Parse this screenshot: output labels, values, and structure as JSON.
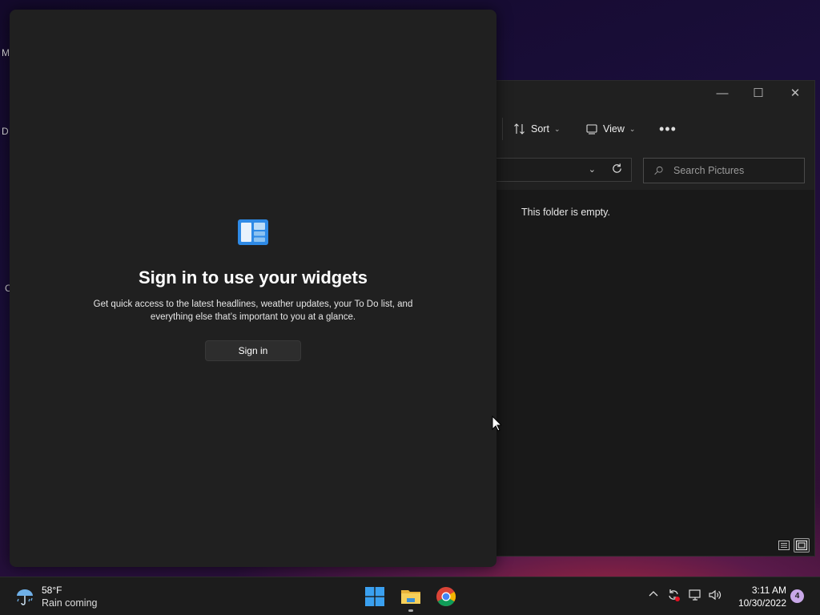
{
  "desktop": {
    "labels": [
      "M",
      "D",
      "C"
    ]
  },
  "explorer": {
    "controls": {
      "minimize": "—",
      "maximize": "☐",
      "close": "✕"
    },
    "toolbar": {
      "sort_label": "Sort",
      "view_label": "View",
      "more_label": "•••"
    },
    "search": {
      "placeholder": "Search Pictures"
    },
    "content": {
      "empty_message": "This folder is empty."
    }
  },
  "widgets": {
    "heading": "Sign in to use your widgets",
    "description": "Get quick access to the latest headlines, weather updates, your To Do list, and everything else that’s important to you at a glance.",
    "sign_in_label": "Sign in"
  },
  "taskbar": {
    "weather": {
      "temperature": "58°F",
      "condition": "Rain coming"
    },
    "clock": {
      "time": "3:11 AM",
      "date": "10/30/2022"
    },
    "notification_count": "4"
  },
  "colors": {
    "accent": "#2e8ae6",
    "panel": "#202020",
    "window": "#191919"
  }
}
